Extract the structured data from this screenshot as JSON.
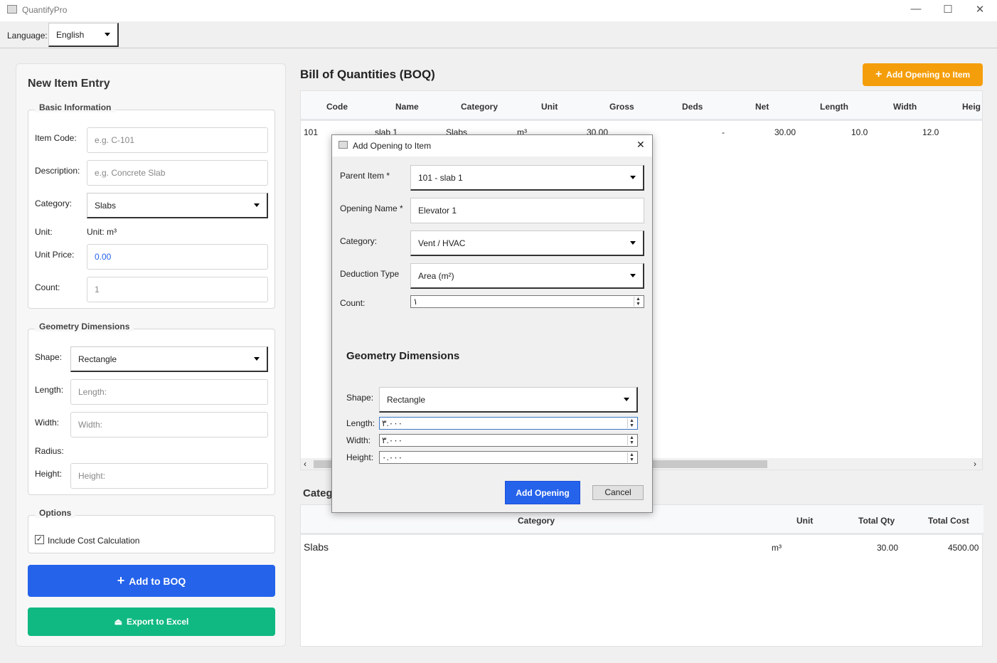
{
  "app": {
    "title": "QuantifyPro"
  },
  "language": {
    "label": "Language:",
    "value": "English"
  },
  "entry": {
    "title": "New Item Entry",
    "basic_label": "Basic Information",
    "item_code_label": "Item Code:",
    "item_code_placeholder": "e.g. C-101",
    "description_label": "Description:",
    "description_placeholder": "e.g. Concrete Slab",
    "category_label": "Category:",
    "category_value": "Slabs",
    "unit_label": "Unit:",
    "unit_value": "Unit: m³",
    "unit_price_label": "Unit Price:",
    "unit_price_value": "0.00",
    "count_label": "Count:",
    "count_value": "1",
    "geometry_label": "Geometry Dimensions",
    "shape_label": "Shape:",
    "shape_value": "Rectangle",
    "length_label": "Length:",
    "length_placeholder": "Length:",
    "width_label": "Width:",
    "width_placeholder": "Width:",
    "radius_label": "Radius:",
    "height_label": "Height:",
    "height_placeholder": "Height:",
    "options_label": "Options",
    "include_cost_label": "Include Cost Calculation",
    "include_cost_checked": true,
    "add_button": "Add to BOQ",
    "export_button": "Export to Excel"
  },
  "boq": {
    "title": "Bill of Quantities (BOQ)",
    "add_opening_button": "Add Opening to Item",
    "columns": [
      "Code",
      "Name",
      "Category",
      "Unit",
      "Gross",
      "Deds",
      "Net",
      "Length",
      "Width",
      "Heig"
    ],
    "rows": [
      [
        "101",
        "slab 1",
        "Slabs",
        "m³",
        "30.00",
        "-",
        "30.00",
        "10.0",
        "12.0",
        ""
      ]
    ]
  },
  "summary": {
    "title": "Categ",
    "columns": [
      "Category",
      "Unit",
      "Total Qty",
      "Total Cost"
    ],
    "rows": [
      [
        "Slabs",
        "m³",
        "30.00",
        "4500.00"
      ]
    ]
  },
  "dialog": {
    "title": "Add Opening to Item",
    "parent_label": "Parent Item *",
    "parent_value": "101 - slab 1",
    "name_label": "Opening Name *",
    "name_value": "Elevator 1",
    "category_label": "Category:",
    "category_value": "Vent / HVAC",
    "deduction_label": "Deduction Type",
    "deduction_value": "Area (m²)",
    "count_label": "Count:",
    "count_value": "۱",
    "geometry_title": "Geometry Dimensions",
    "shape_label": "Shape:",
    "shape_value": "Rectangle",
    "length_label": "Length:",
    "length_value": "۳.۰۰۰",
    "width_label": "Width:",
    "width_value": "۳.۰۰۰",
    "height_label": "Height:",
    "height_value": "۰.۰۰۰",
    "add_button": "Add Opening",
    "cancel_button": "Cancel"
  },
  "colors": {
    "primary": "#2563eb",
    "success": "#10b981",
    "accent": "#f59e0b"
  }
}
